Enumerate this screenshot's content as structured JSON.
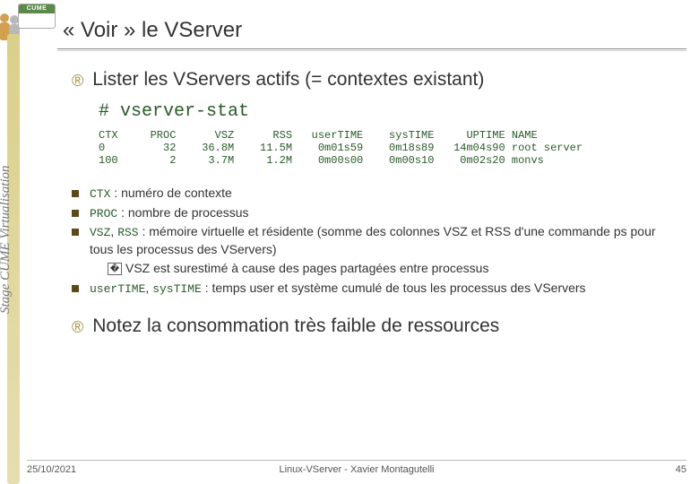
{
  "branding": {
    "logo_text": "CUME",
    "sidebar_text": "Stage CUME Virtualisation"
  },
  "title": "« Voir » le VServer",
  "bullets": {
    "b1": "Lister les VServers actifs (= contextes existant)",
    "b2": "Notez la consommation très faible de ressources"
  },
  "command": "# vserver-stat",
  "table": {
    "headers": [
      "CTX",
      "PROC",
      "VSZ",
      "RSS",
      "userTIME",
      "sysTIME",
      "UPTIME",
      "NAME"
    ],
    "rows": [
      [
        "0",
        "32",
        "36.8M",
        "11.5M",
        "0m01s59",
        "0m18s89",
        "14m04s90",
        "root server"
      ],
      [
        "100",
        "2",
        "3.7M",
        "1.2M",
        "0m00s00",
        "0m00s10",
        "0m02s20",
        "monvs"
      ]
    ]
  },
  "defs": {
    "d1_code": "CTX",
    "d1_text": " : numéro de contexte",
    "d2_code": "PROC",
    "d2_text": " : nombre de processus",
    "d3_code1": "VSZ",
    "d3_code2": "RSS",
    "d3_text": " : mémoire virtuelle et résidente (somme des colonnes VSZ et RSS d'une commande ps pour tous les processus des VServers)",
    "d3_sub": "VSZ est surestimé à cause des pages partagées entre processus",
    "d4_code1": "userTIME",
    "d4_code2": "sysTIME",
    "d4_text": " : temps user et système cumulé de tous les processus des VServers"
  },
  "footer": {
    "left": "25/10/2021",
    "center": "Linux-VServer - Xavier Montagutelli",
    "right": "45"
  }
}
